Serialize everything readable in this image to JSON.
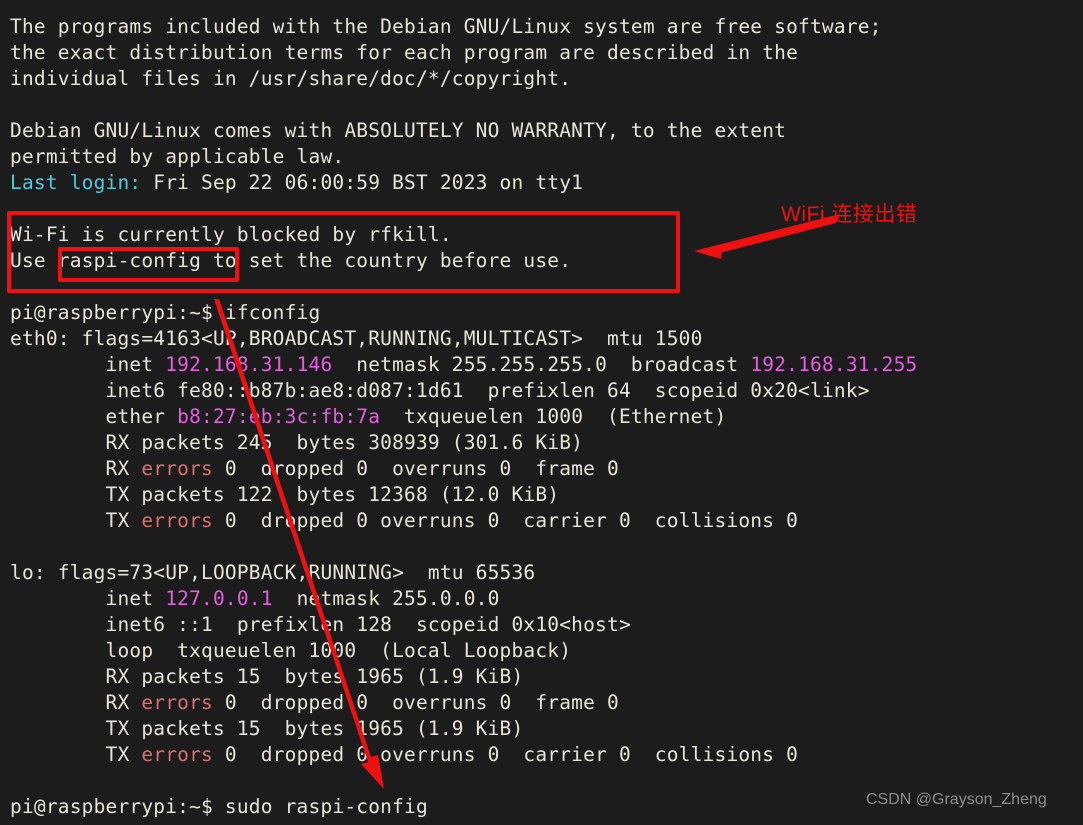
{
  "terminal": {
    "background_color": "#1c1c1c",
    "foreground_color": "#e8e4da",
    "cyan_color": "#55c8dc",
    "magenta_color": "#e45fe0",
    "error_color": "#e06c6c",
    "lines": [
      {
        "id": "l01",
        "segments": [
          {
            "text": "The programs included with the Debian GNU/Linux system are free software;",
            "color": "white"
          }
        ]
      },
      {
        "id": "l02",
        "segments": [
          {
            "text": "the exact distribution terms for each program are described in the",
            "color": "white"
          }
        ]
      },
      {
        "id": "l03",
        "segments": [
          {
            "text": "individual files in /usr/share/doc/*/copyright.",
            "color": "white"
          }
        ]
      },
      {
        "id": "l04",
        "segments": [
          {
            "text": "",
            "color": "white"
          }
        ]
      },
      {
        "id": "l05",
        "segments": [
          {
            "text": "Debian GNU/Linux comes with ABSOLUTELY NO WARRANTY, to the extent",
            "color": "white"
          }
        ]
      },
      {
        "id": "l06",
        "segments": [
          {
            "text": "permitted by applicable law.",
            "color": "white"
          }
        ]
      },
      {
        "id": "l07",
        "segments": [
          {
            "text": "Last login:",
            "color": "cyan"
          },
          {
            "text": " Fri Sep 22 06:00:59 BST 2023 on tty1",
            "color": "white"
          }
        ]
      },
      {
        "id": "l08",
        "segments": [
          {
            "text": "",
            "color": "white"
          }
        ]
      },
      {
        "id": "l09",
        "segments": [
          {
            "text": "Wi-Fi is currently blocked by rfkill.",
            "color": "white"
          }
        ]
      },
      {
        "id": "l10",
        "segments": [
          {
            "text": "Use raspi-config to set the country before use.",
            "color": "white"
          }
        ]
      },
      {
        "id": "l11",
        "segments": [
          {
            "text": "",
            "color": "white"
          }
        ]
      },
      {
        "id": "l12",
        "segments": [
          {
            "text": "pi@raspberrypi:~$ ifconfig",
            "color": "white"
          }
        ]
      },
      {
        "id": "l13",
        "segments": [
          {
            "text": "eth0: flags=4163<UP,BROADCAST,RUNNING,MULTICAST>  mtu 1500",
            "color": "white"
          }
        ]
      },
      {
        "id": "l14",
        "segments": [
          {
            "text": "        inet ",
            "color": "white"
          },
          {
            "text": "192.168.31.146",
            "color": "magenta"
          },
          {
            "text": "  netmask 255.255.255.0  broadcast ",
            "color": "white"
          },
          {
            "text": "192.168.31.255",
            "color": "magenta"
          }
        ]
      },
      {
        "id": "l15",
        "segments": [
          {
            "text": "        inet6 fe80::b87b:ae8:d087:1d61  prefixlen 64  scopeid 0x20<link>",
            "color": "white"
          }
        ]
      },
      {
        "id": "l16",
        "segments": [
          {
            "text": "        ether ",
            "color": "white"
          },
          {
            "text": "b8:27:eb:3c:fb:7a",
            "color": "magenta"
          },
          {
            "text": "  txqueuelen 1000  (Ethernet)",
            "color": "white"
          }
        ]
      },
      {
        "id": "l17",
        "segments": [
          {
            "text": "        RX packets 245  bytes 308939 (301.6 KiB)",
            "color": "white"
          }
        ]
      },
      {
        "id": "l18",
        "segments": [
          {
            "text": "        RX ",
            "color": "white"
          },
          {
            "text": "errors",
            "color": "red"
          },
          {
            "text": " 0  dropped 0  overruns 0  frame 0",
            "color": "white"
          }
        ]
      },
      {
        "id": "l19",
        "segments": [
          {
            "text": "        TX packets 122  bytes 12368 (12.0 KiB)",
            "color": "white"
          }
        ]
      },
      {
        "id": "l20",
        "segments": [
          {
            "text": "        TX ",
            "color": "white"
          },
          {
            "text": "errors",
            "color": "red"
          },
          {
            "text": " 0  dropped 0 overruns 0  carrier 0  collisions 0",
            "color": "white"
          }
        ]
      },
      {
        "id": "l21",
        "segments": [
          {
            "text": "",
            "color": "white"
          }
        ]
      },
      {
        "id": "l22",
        "segments": [
          {
            "text": "lo: flags=73<UP,LOOPBACK,RUNNING>  mtu 65536",
            "color": "white"
          }
        ]
      },
      {
        "id": "l23",
        "segments": [
          {
            "text": "        inet ",
            "color": "white"
          },
          {
            "text": "127.0.0.1",
            "color": "magenta"
          },
          {
            "text": "  netmask 255.0.0.0",
            "color": "white"
          }
        ]
      },
      {
        "id": "l24",
        "segments": [
          {
            "text": "        inet6 ::1  prefixlen 128  scopeid 0x10<host>",
            "color": "white"
          }
        ]
      },
      {
        "id": "l25",
        "segments": [
          {
            "text": "        loop  txqueuelen 1000  (Local Loopback)",
            "color": "white"
          }
        ]
      },
      {
        "id": "l26",
        "segments": [
          {
            "text": "        RX packets 15  bytes 1965 (1.9 KiB)",
            "color": "white"
          }
        ]
      },
      {
        "id": "l27",
        "segments": [
          {
            "text": "        RX ",
            "color": "white"
          },
          {
            "text": "errors",
            "color": "red"
          },
          {
            "text": " 0  dropped 0  overruns 0  frame 0",
            "color": "white"
          }
        ]
      },
      {
        "id": "l28",
        "segments": [
          {
            "text": "        TX packets 15  bytes 1965 (1.9 KiB)",
            "color": "white"
          }
        ]
      },
      {
        "id": "l29",
        "segments": [
          {
            "text": "        TX ",
            "color": "white"
          },
          {
            "text": "errors",
            "color": "red"
          },
          {
            "text": " 0  dropped 0 overruns 0  carrier 0  collisions 0",
            "color": "white"
          }
        ]
      },
      {
        "id": "l30",
        "segments": [
          {
            "text": "",
            "color": "white"
          }
        ]
      },
      {
        "id": "l31",
        "segments": [
          {
            "text": "pi@raspberrypi:~$ sudo raspi-config",
            "color": "white"
          }
        ]
      }
    ]
  },
  "annotations": {
    "color": "#ee1111",
    "label_text": "WiFi 连接出错",
    "highlight_box_label": "wifi-blocked-message",
    "inner_box_label": "raspi-config"
  },
  "watermark": {
    "text": "CSDN @Grayson_Zheng",
    "color": "#8c8c8c"
  }
}
